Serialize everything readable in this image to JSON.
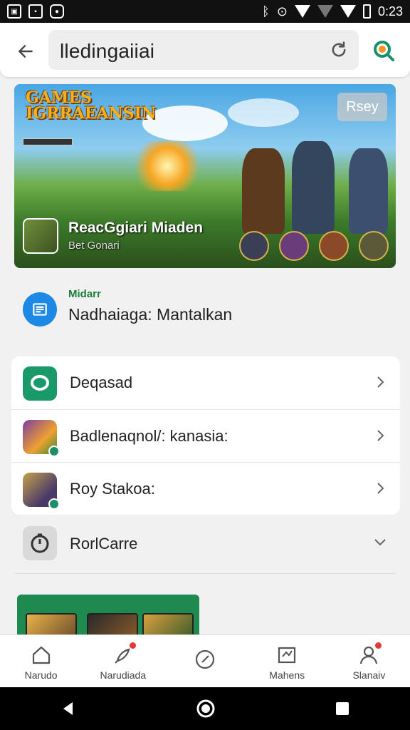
{
  "status_bar": {
    "time": "0:23",
    "icons": [
      "gallery-icon",
      "image-icon",
      "app-icon",
      "bluetooth-icon",
      "alarm-icon",
      "wifi-icon",
      "signal-icon",
      "battery-icon"
    ]
  },
  "app_bar": {
    "back_icon": "arrow-left-icon",
    "url_text": "lledingaiiai",
    "reload_icon": "reload-icon",
    "lens_icon": "lens-icon"
  },
  "hero": {
    "logo_line1": "GAMES",
    "logo_line2": "IGRRAEANSIN",
    "play_label": "Rsey",
    "title": "ReacGgiari Miaden",
    "subtitle": "Bet Gonari"
  },
  "info": {
    "small_label": "Midarr",
    "title": "Nadhaiaga: Mantalkan"
  },
  "list": {
    "items": [
      {
        "label": "Deqasad",
        "icon": "chat-bubble-icon"
      },
      {
        "label": "Badlenaqnol/: kanasia:",
        "icon": "game-app-icon"
      },
      {
        "label": "Roy Stakoa:",
        "icon": "warrior-app-icon"
      }
    ],
    "expand_item": {
      "label": "RorlCarre",
      "icon": "timer-icon"
    }
  },
  "bottom_nav": {
    "items": [
      {
        "label": "Narudo",
        "icon": "home-icon"
      },
      {
        "label": "Narudiada",
        "icon": "rocket-icon"
      },
      {
        "label": "",
        "icon": "clock-icon"
      },
      {
        "label": "Mahens",
        "icon": "inbox-icon"
      },
      {
        "label": "Slanaiv",
        "icon": "profile-icon"
      }
    ]
  },
  "colors": {
    "accent_green": "#1a7f3c",
    "info_blue": "#1e88e5",
    "badge_red": "#e53935",
    "promo_green": "#1f8a4f"
  }
}
